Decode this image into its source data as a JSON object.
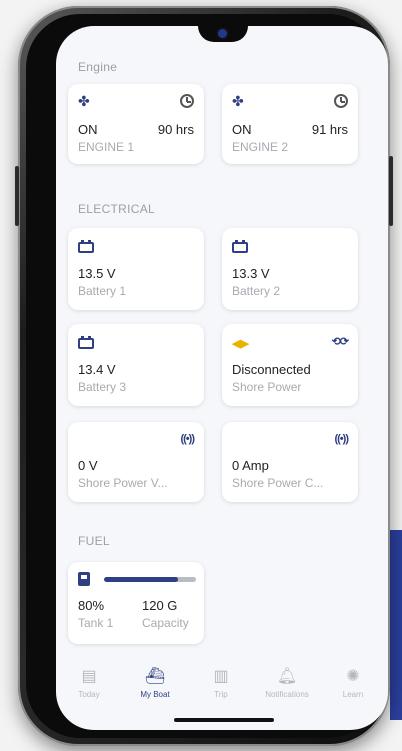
{
  "sections": {
    "engine": "Engine",
    "electrical": "ELECTRICAL",
    "fuel": "FUEL"
  },
  "engines": [
    {
      "status": "ON",
      "hours": "90 hrs",
      "name": "ENGINE 1"
    },
    {
      "status": "ON",
      "hours": "91 hrs",
      "name": "ENGINE 2"
    }
  ],
  "electrical": [
    {
      "value": "13.5 V",
      "label": "Battery 1"
    },
    {
      "value": "13.3 V",
      "label": "Battery 2"
    },
    {
      "value": "13.4 V",
      "label": "Battery 3"
    },
    {
      "value": "Disconnected",
      "label": "Shore Power"
    },
    {
      "value": "0 V",
      "label": "Shore Power V..."
    },
    {
      "value": "0 Amp",
      "label": "Shore Power C..."
    }
  ],
  "fuel": {
    "percent": "80%",
    "percent_label": "Tank 1",
    "capacity": "120 G",
    "capacity_label": "Capacity",
    "level": 0.8
  },
  "tabs": [
    {
      "label": "Today",
      "icon": "today-icon"
    },
    {
      "label": "My Boat",
      "icon": "boat-icon",
      "active": true
    },
    {
      "label": "Trip",
      "icon": "map-icon"
    },
    {
      "label": "Notifications",
      "icon": "bell-icon"
    },
    {
      "label": "Learn",
      "icon": "bulb-icon"
    }
  ],
  "colors": {
    "accent": "#2f3f84",
    "warning": "#e7b400"
  }
}
